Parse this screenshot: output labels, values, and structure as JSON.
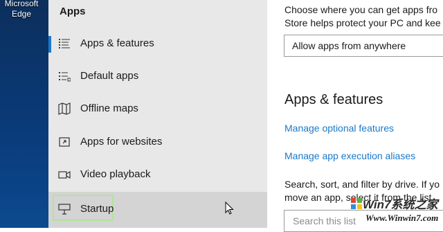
{
  "desktop": {
    "icon_label_line1": "Microsoft",
    "icon_label_line2": "Edge"
  },
  "sidebar": {
    "title": "Apps",
    "items": [
      {
        "label": "Apps & features",
        "icon": "list-icon"
      },
      {
        "label": "Default apps",
        "icon": "default-apps-icon"
      },
      {
        "label": "Offline maps",
        "icon": "map-icon"
      },
      {
        "label": "Apps for websites",
        "icon": "web-link-icon"
      },
      {
        "label": "Video playback",
        "icon": "video-icon"
      },
      {
        "label": "Startup",
        "icon": "startup-icon"
      }
    ],
    "active_index": 0,
    "hover_index": 5
  },
  "main": {
    "intro_line1": "Choose where you can get apps fro",
    "intro_line2": "Store helps protect your PC and kee",
    "install_dropdown": {
      "value": "Allow apps from anywhere"
    },
    "section_title": "Apps & features",
    "link_optional_features": "Manage optional features",
    "link_execution_aliases": "Manage app execution aliases",
    "filter_line1": "Search, sort, and filter by drive. If yo",
    "filter_line2": "move an app, select it from the list.",
    "search": {
      "placeholder": "Search this list"
    }
  },
  "watermark": {
    "brand": "Win7系统之家",
    "url": "Www.Winwin7.com"
  },
  "colors": {
    "accent": "#1979ca",
    "sidebar_bg": "#e8e8e8",
    "focus": "#b3e39b"
  }
}
